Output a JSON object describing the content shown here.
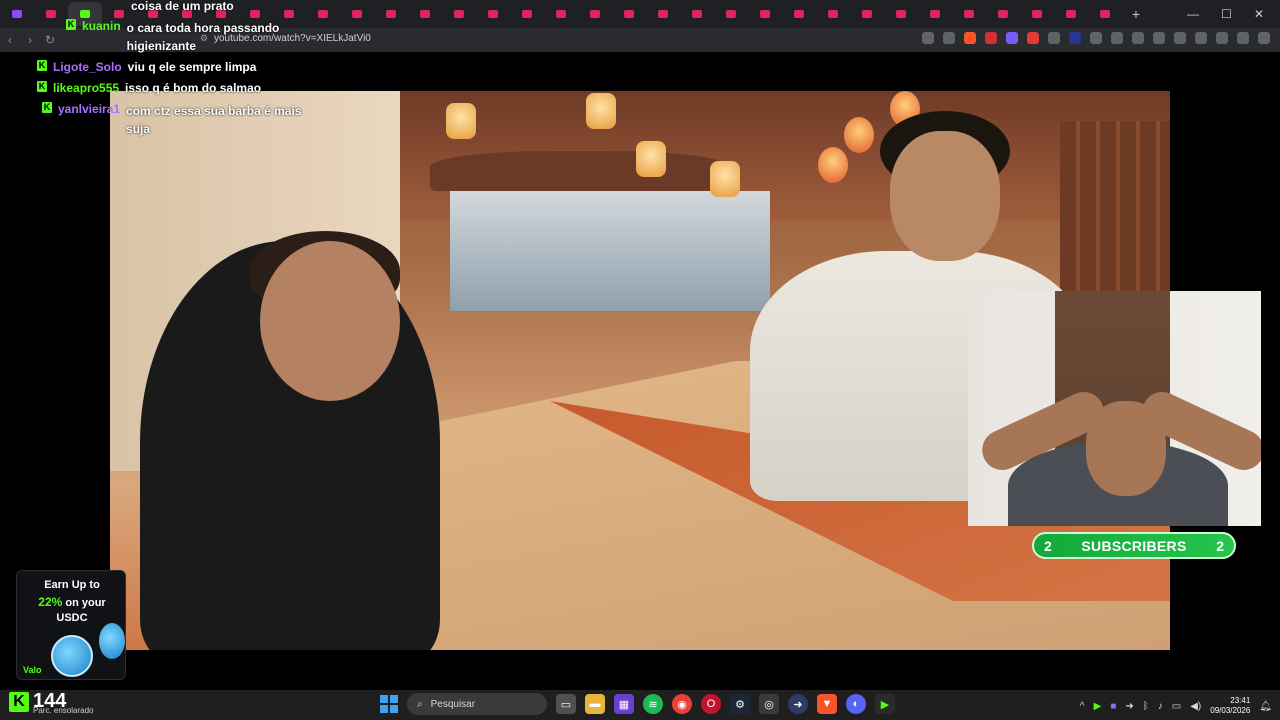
{
  "browser": {
    "url": "youtube.com/watch?v=XIELkJatVi0",
    "new_tab_label": "+",
    "window_controls": [
      "—",
      "☐",
      "✕"
    ]
  },
  "chat": {
    "messages": [
      {
        "user": "",
        "text": "coisa de um prato"
      },
      {
        "user": "kuanin",
        "text": "o cara toda hora passando higienizante"
      },
      {
        "user": "Ligote_Solo",
        "text": "viu q ele sempre limpa"
      },
      {
        "user": "likeapro555",
        "text": "isso q é bom do salmao"
      },
      {
        "user": "yanlvieira1",
        "text": "com ctz essa sua barba é mais suja"
      }
    ]
  },
  "subscribers_badge": {
    "left_count": "2",
    "label": "SUBSCRIBERS",
    "right_count": "2",
    "color": "#22b548"
  },
  "ad_widget": {
    "line1": "Earn Up to",
    "percent": "22%",
    "line2": "on your",
    "line3": "USDC",
    "brand": "Valo"
  },
  "kick_overlay": {
    "viewer_count": "144",
    "subtitle": "Parc. ensolarado"
  },
  "taskbar": {
    "search_placeholder": "Pesquisar",
    "time": "23:41",
    "date": "09/03/2026"
  },
  "colors": {
    "kick_green": "#53fc18",
    "youtube_red": "#e0245e"
  }
}
